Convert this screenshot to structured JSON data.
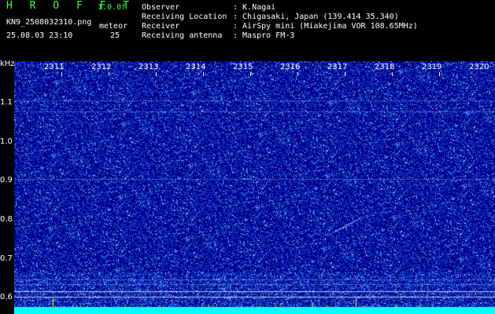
{
  "header": {
    "title": "H R O F F T",
    "version": "1.0.0f",
    "filename": "KN9_2508032310.png",
    "datetime": "25.08.03 23:10",
    "mode_label": "meteor",
    "mode_value": "25",
    "observer_label": "Observer",
    "observer_value": ": K.Nagai",
    "location_label": "Receiving Location",
    "location_value": ": Chigasaki, Japan (139.414 35.340)",
    "receiver_label": "Receiver",
    "receiver_value": ": AirSpy mini (Miakejima VOR 108.65MHz)",
    "antenna_label": "Receiving antenna",
    "antenna_value": ": Maspro FM-3"
  },
  "axis": {
    "unit": "kHz",
    "y_ticks": [
      "1.1",
      "1.0",
      "0.9",
      "0.8",
      "0.7",
      "0.6"
    ],
    "x_ticks": [
      "2311",
      "2312",
      "2313",
      "2314",
      "2315",
      "2316",
      "2317",
      "2318",
      "2319",
      "2320"
    ]
  },
  "colors": {
    "background": "#00008a",
    "noise": "#3c8cff",
    "header_green": "#3cff3c",
    "baseline": "#00ffff",
    "spike": "#ffff00"
  }
}
